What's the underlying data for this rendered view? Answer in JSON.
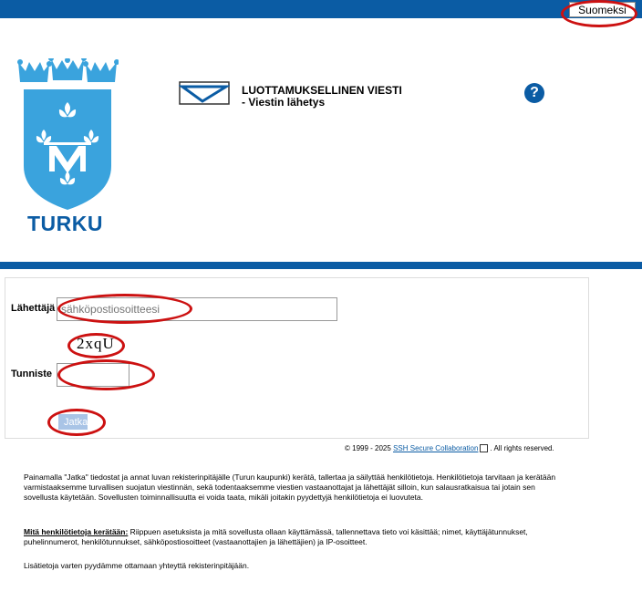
{
  "header": {
    "language_button": "Suomeksi"
  },
  "brand": {
    "name": "TURKU"
  },
  "app": {
    "title_line1": "LUOTTAMUKSELLINEN VIESTI",
    "title_line2": "- Viestin lähetys",
    "help_symbol": "?"
  },
  "form": {
    "sender_label": "Lähettäjä",
    "sender_placeholder": "sähköpostiosoitteesi",
    "captcha_text": "2xqU",
    "code_label": "Tunniste",
    "submit_label": "Jatka"
  },
  "footer": {
    "copyright_prefix": "© 1999 - 2025",
    "copyright_link": "SSH Secure Collaboration",
    "copyright_suffix": ". All rights reserved."
  },
  "info": {
    "paragraph1": "Painamalla \"Jatka\" tiedostat ja annat luvan rekisterinpitäjälle (Turun kaupunki) kerätä, tallertaa ja säilyttää henkilötietoja. Henkilötietoja tarvitaan ja kerätään varmistaaksemme turvallisen suojatun viestinnän, sekä todentaaksemme viestien vastaanottajat ja lähettäjät silloin, kun salausratkaisua tai jotain sen sovellusta käytetään. Sovellusten toiminnallisuutta ei voida taata, mikäli joitakin pyydettyjä henkilötietoja ei luovuteta.",
    "paragraph2_heading": "Mitä henkilötietoja kerätään:",
    "paragraph2_body": " Riippuen asetuksista ja mitä sovellusta ollaan käyttämässä, tallennettava tieto voi käsittää; nimet, käyttäjätunnukset, puhelinnumerot, henkilötunnukset, sähköpostiosoitteet (vastaanottajien ja lähettäjien) ja IP-osoitteet.",
    "paragraph3": "Lisätietoja varten pyydämme ottamaan yhteyttä rekisterinpitäjään."
  },
  "colors": {
    "brand_blue": "#0b5ca4",
    "crest_blue": "#3aa3dd",
    "annotation_red": "#cc1111",
    "button_disabled": "#a9c4e6"
  }
}
